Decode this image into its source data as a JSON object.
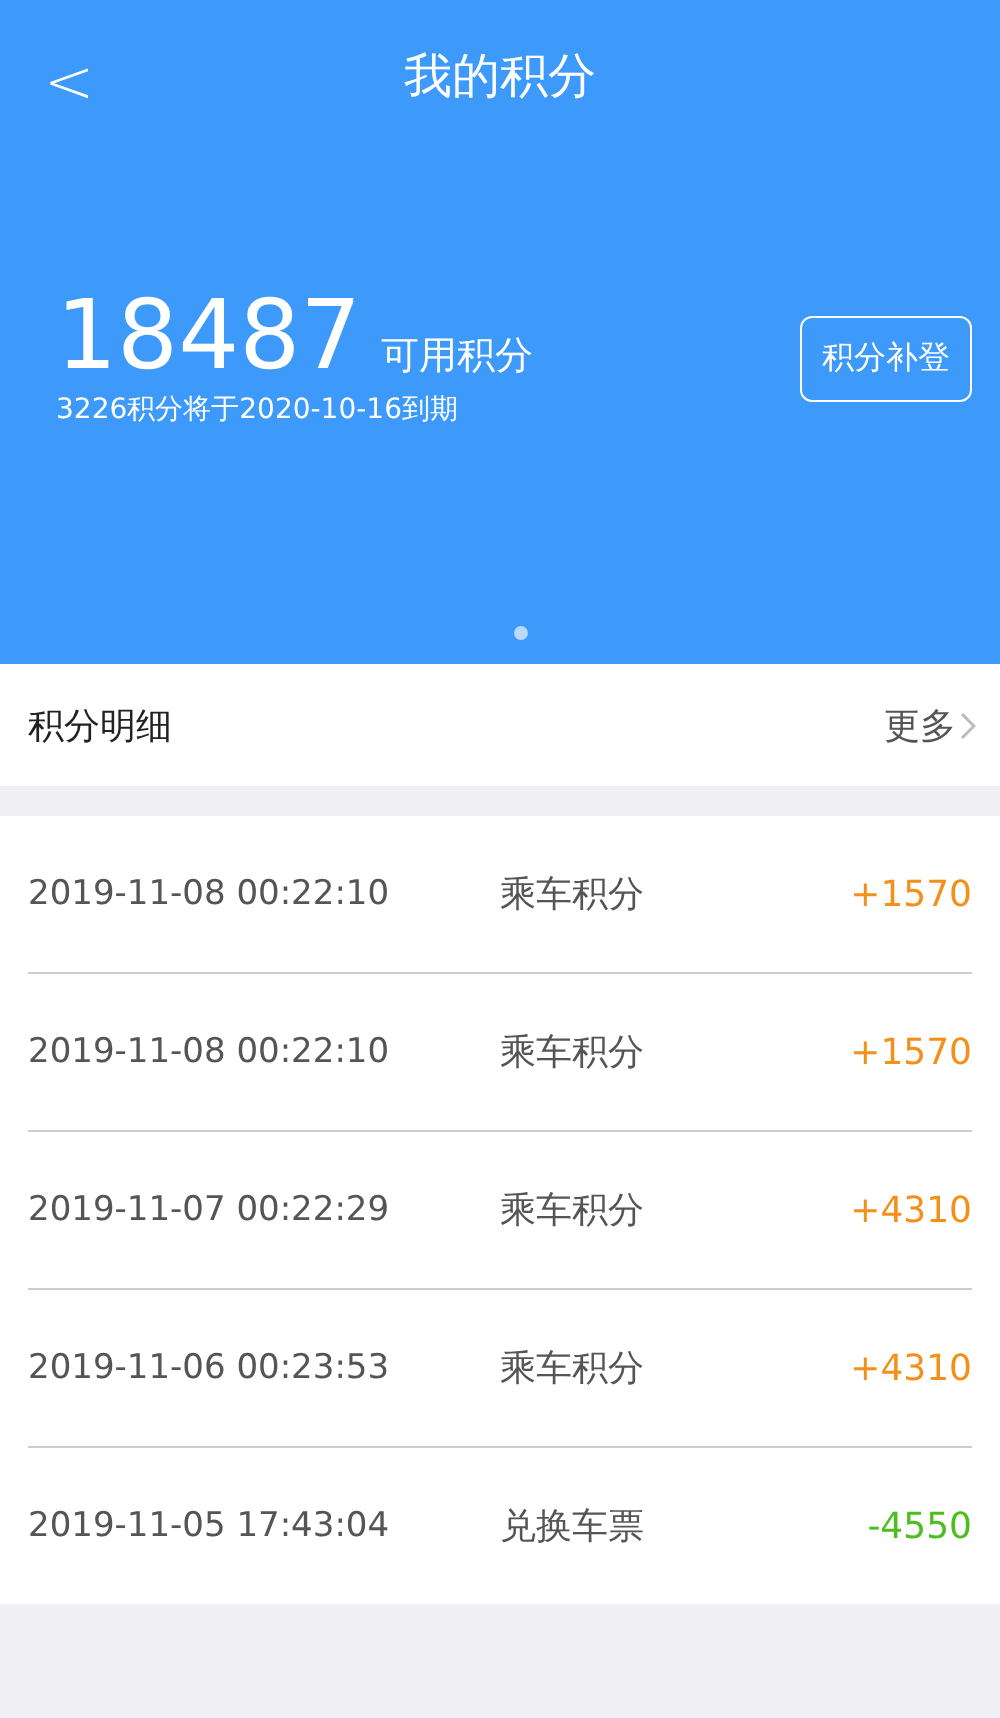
{
  "header": {
    "back": "<",
    "title": "我的积分"
  },
  "points": {
    "value": "18487",
    "label": "可用积分",
    "expiry": "3226积分将于2020-10-16到期",
    "button": "积分补登"
  },
  "detail": {
    "title": "积分明细",
    "more": "更多"
  },
  "records": [
    {
      "time": "2019-11-08 00:22:10",
      "type": "乘车积分",
      "amount": "+1570",
      "kind": "earn"
    },
    {
      "time": "2019-11-08 00:22:10",
      "type": "乘车积分",
      "amount": "+1570",
      "kind": "earn"
    },
    {
      "time": "2019-11-07 00:22:29",
      "type": "乘车积分",
      "amount": "+4310",
      "kind": "earn"
    },
    {
      "time": "2019-11-06 00:23:53",
      "type": "乘车积分",
      "amount": "+4310",
      "kind": "earn"
    },
    {
      "time": "2019-11-05 17:43:04",
      "type": "兑换车票",
      "amount": "-4550",
      "kind": "spend"
    }
  ]
}
